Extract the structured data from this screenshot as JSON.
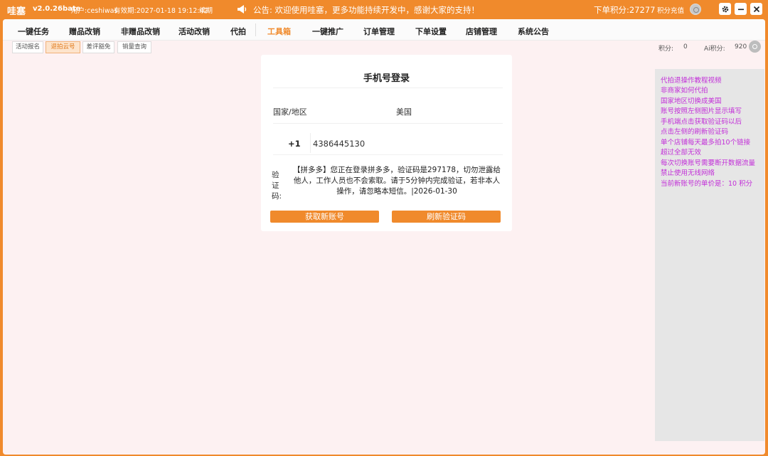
{
  "titlebar": {
    "app_name": "哇塞",
    "version": "v2.0.26bate",
    "user": "用户:ceshiwas",
    "expiry": "有效期:2027-01-18 19:12:42",
    "renew": "续期",
    "notice": "公告: 欢迎使用哇塞，更多功能持续开发中，感谢大家的支持！",
    "points": "下单积分:27277",
    "recharge": "积分充值"
  },
  "nav": {
    "items": [
      "一键任务",
      "赠品改销",
      "非赠品改销",
      "活动改销",
      "代拍",
      "工具箱",
      "一键推广",
      "订单管理",
      "下单设置",
      "店铺管理",
      "系统公告"
    ],
    "active": "工具箱"
  },
  "subnav": {
    "items": [
      "活动报名",
      "退拍云号",
      "差评豁免",
      "销量查询"
    ],
    "active": "退拍云号"
  },
  "top_right": {
    "points_label": "积分:",
    "points_value": "0",
    "ai_label": "Ai积分:",
    "ai_value": "920"
  },
  "login": {
    "title": "手机号登录",
    "country_label": "国家/地区",
    "country_value": "美国",
    "phone_code": "+1",
    "phone_number": "4386445130",
    "code_label": "验证码:",
    "sms_text": "【拼多多】您正在登录拼多多，验证码是297178，切勿泄露给他人，工作人员也不会索取。请于5分钟内完成验证，若非本人操作，请忽略本短信。|2026-01-30",
    "get_button": "获取新账号",
    "refresh_button": "刷新验证码"
  },
  "sidebar": {
    "lines": [
      "代拍退操作教程视频",
      "非商家如何代拍",
      "国家地区切换成美国",
      "账号按照左侧图片显示填写",
      "手机端点击获取验证码以后",
      "点击左侧的刷新验证码",
      "单个店铺每天最多拍10个链接",
      "超过全部无效",
      "每次切换账号需要断开数据流量",
      "禁止使用无线网络",
      "当前新账号的单价是：10 积分"
    ]
  }
}
